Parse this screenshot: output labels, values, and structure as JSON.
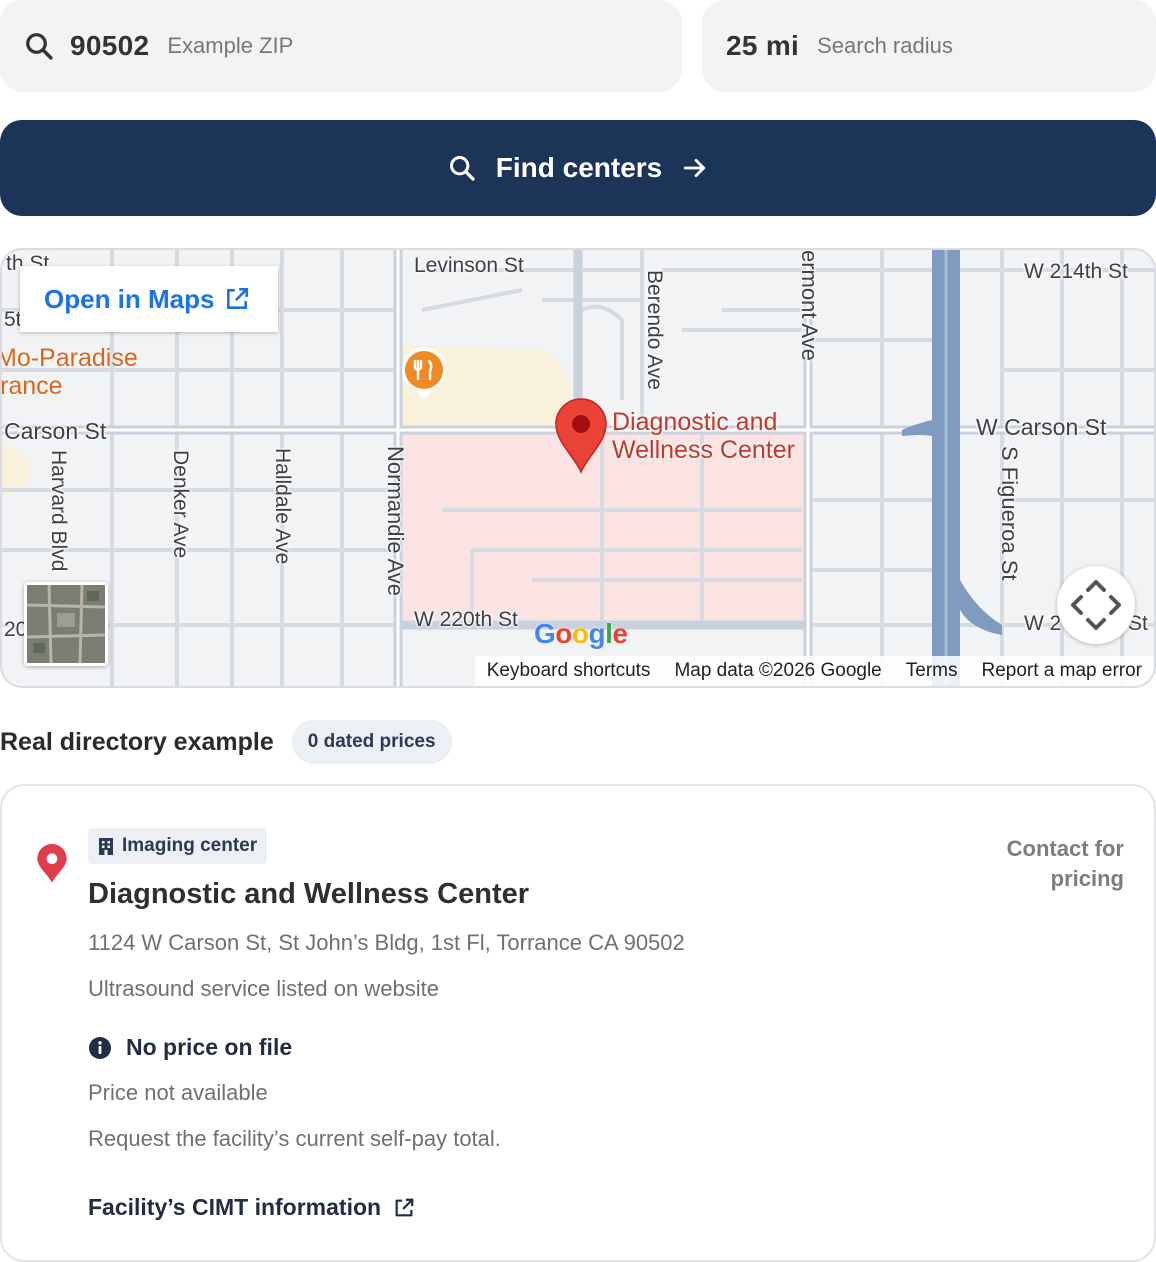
{
  "search": {
    "zip_value": "90502",
    "zip_hint": "Example ZIP",
    "radius_value": "25 mi",
    "radius_hint": "Search radius",
    "button_label": "Find centers"
  },
  "map": {
    "open_in_maps": "Open in Maps",
    "marker_label_line1": "Diagnostic and",
    "marker_label_line2": "Wellness Center",
    "poi_line1": "Mo-Paradise",
    "poi_line2": "rance",
    "streets": {
      "levinson": "Levinson St",
      "w214": "W 214th St",
      "carson_left": "Carson St",
      "carson_right": "W Carson St",
      "w220": "W 220th St",
      "w22x": "W 2",
      "st_suffix": "St",
      "harvard": "Harvard Blvd",
      "denker": "Denker Ave",
      "halldale": "Halldale Ave",
      "normandie": "Normandie Ave",
      "berendo": "Berendo Ave",
      "vermont": "ermont Ave",
      "figueroa": "S Figueroa St",
      "top_left": "th St",
      "left_5": "5t",
      "left_20": "20"
    },
    "google_logo": "Google",
    "attribution": {
      "shortcuts": "Keyboard shortcuts",
      "data": "Map data ©2026 Google",
      "terms": "Terms",
      "report": "Report a map error"
    }
  },
  "directory": {
    "title": "Real directory example",
    "badge": "0 dated prices"
  },
  "facility": {
    "type": "Imaging center",
    "name": "Diagnostic and Wellness Center",
    "pricing": "Contact for pricing",
    "address": "1124 W Carson St, St John’s Bldg, 1st Fl, Torrance CA 90502",
    "service": "Ultrasound service listed on website",
    "price_status": "No price on file",
    "price_note": "Price not available",
    "request_note": "Request the facility’s current self-pay total.",
    "info_link": "Facility’s CIMT information"
  },
  "colors": {
    "primary_navy": "#1c3457",
    "map_link_blue": "#1a73e8",
    "marker_red": "#ea4335",
    "pin_red": "#e03c4c"
  }
}
